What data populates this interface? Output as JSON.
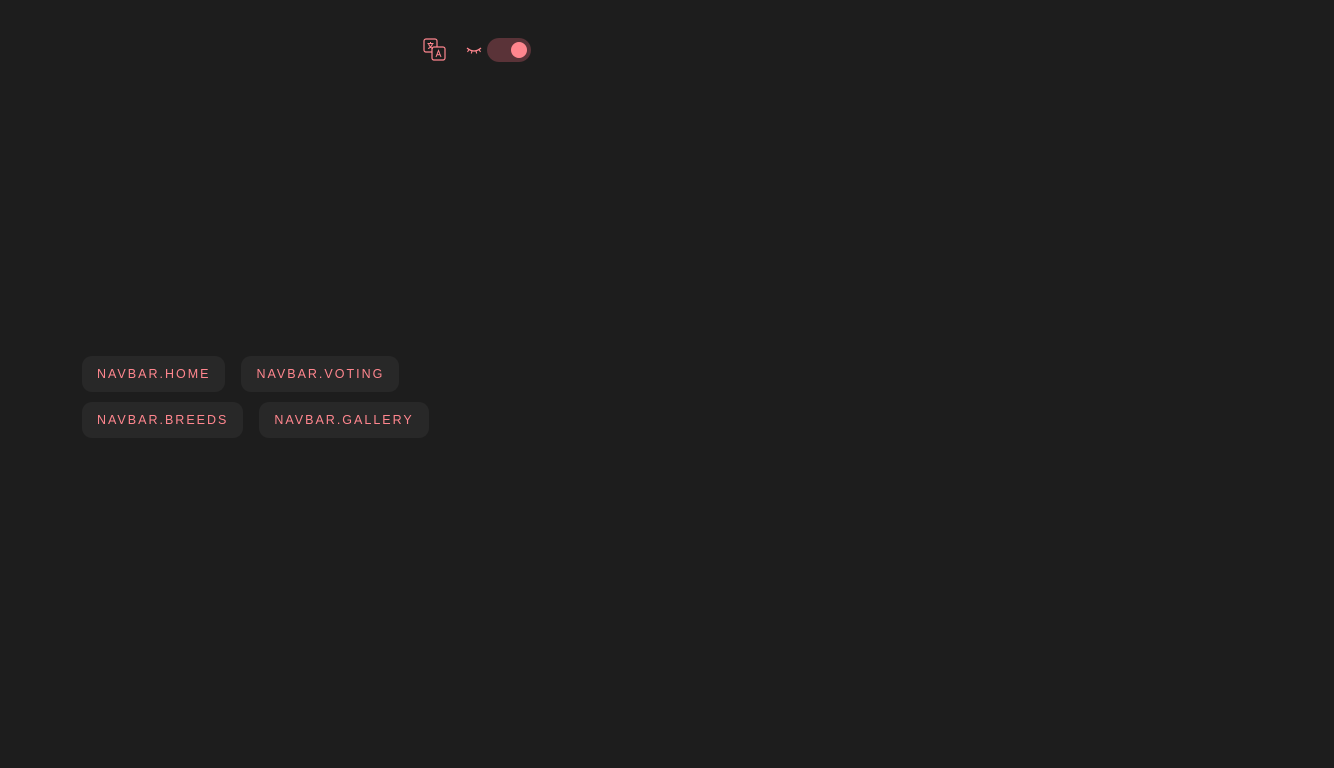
{
  "header": {
    "translate_icon": "translate-icon",
    "theme_icon": "closed-eye-icon",
    "theme_toggle_on": true
  },
  "navbar": {
    "rows": [
      [
        "NAVBAR.HOME",
        "NAVBAR.VOTING"
      ],
      [
        "NAVBAR.BREEDS",
        "NAVBAR.GALLERY"
      ]
    ]
  },
  "colors": {
    "background": "#1d1d1d",
    "accent": "#ff868e",
    "button_bg": "#282828",
    "toggle_track": "#5a3338"
  }
}
